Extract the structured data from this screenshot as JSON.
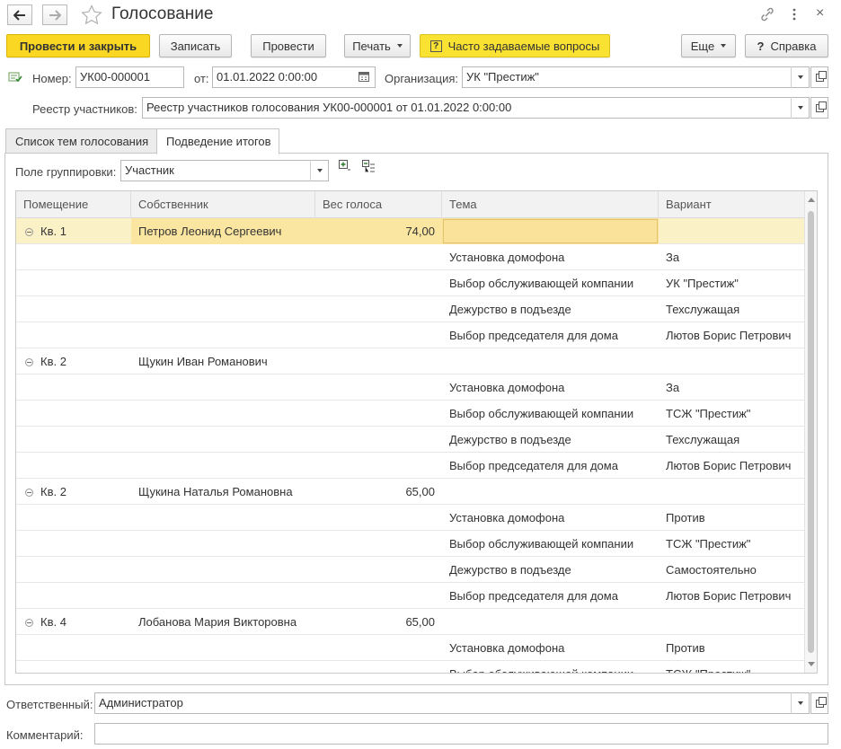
{
  "window": {
    "title": "Голосование",
    "link_icon": "link-icon",
    "more_icon": "more-vertical-icon",
    "close_label": "×"
  },
  "toolbar": {
    "post_close": "Провести и закрыть",
    "save": "Записать",
    "post": "Провести",
    "print": "Печать",
    "faq": "Часто задаваемые вопросы",
    "more": "Еще",
    "help": "Справка"
  },
  "header": {
    "number_label": "Номер:",
    "number_value": "УК00-000001",
    "date_label": "от:",
    "date_value": "01.01.2022  0:00:00",
    "org_label": "Организация:",
    "org_value": "УК \"Престиж\"",
    "registry_label": "Реестр участников:",
    "registry_value": "Реестр участников голосования УК00-000001 от 01.01.2022 0:00:00"
  },
  "tabs": [
    {
      "label": "Список тем голосования"
    },
    {
      "label": "Подведение итогов"
    }
  ],
  "grouping": {
    "label": "Поле группировки:",
    "value": "Участник"
  },
  "table": {
    "columns": [
      "Помещение",
      "Собственник",
      "Вес голоса",
      "Тема",
      "Вариант"
    ],
    "rows": [
      {
        "type": "group",
        "room": "Кв. 1",
        "owner": "Петров Леонид Сергеевич",
        "weight": "74,00",
        "topic": "",
        "variant": ""
      },
      {
        "type": "item",
        "room": "",
        "owner": "",
        "weight": "",
        "topic": "Установка домофона",
        "variant": "За"
      },
      {
        "type": "item",
        "room": "",
        "owner": "",
        "weight": "",
        "topic": "Выбор обслуживающей компании",
        "variant": "УК \"Престиж\""
      },
      {
        "type": "item",
        "room": "",
        "owner": "",
        "weight": "",
        "topic": "Дежурство в подъезде",
        "variant": "Техслужащая"
      },
      {
        "type": "item",
        "room": "",
        "owner": "",
        "weight": "",
        "topic": "Выбор председателя для дома",
        "variant": "Лютов Борис Петрович"
      },
      {
        "type": "group",
        "room": "Кв. 2",
        "owner": "Щукин Иван Романович",
        "weight": "",
        "topic": "",
        "variant": ""
      },
      {
        "type": "item",
        "room": "",
        "owner": "",
        "weight": "",
        "topic": "Установка домофона",
        "variant": "За"
      },
      {
        "type": "item",
        "room": "",
        "owner": "",
        "weight": "",
        "topic": "Выбор обслуживающей компании",
        "variant": "ТСЖ \"Престиж\""
      },
      {
        "type": "item",
        "room": "",
        "owner": "",
        "weight": "",
        "topic": "Дежурство в подъезде",
        "variant": "Техслужащая"
      },
      {
        "type": "item",
        "room": "",
        "owner": "",
        "weight": "",
        "topic": "Выбор председателя для дома",
        "variant": "Лютов Борис Петрович"
      },
      {
        "type": "group",
        "room": "Кв. 2",
        "owner": "Щукина Наталья Романовна",
        "weight": "65,00",
        "topic": "",
        "variant": ""
      },
      {
        "type": "item",
        "room": "",
        "owner": "",
        "weight": "",
        "topic": "Установка домофона",
        "variant": "Против"
      },
      {
        "type": "item",
        "room": "",
        "owner": "",
        "weight": "",
        "topic": "Выбор обслуживающей компании",
        "variant": "ТСЖ \"Престиж\""
      },
      {
        "type": "item",
        "room": "",
        "owner": "",
        "weight": "",
        "topic": "Дежурство в подъезде",
        "variant": "Самостоятельно"
      },
      {
        "type": "item",
        "room": "",
        "owner": "",
        "weight": "",
        "topic": "Выбор председателя для дома",
        "variant": "Лютов Борис Петрович"
      },
      {
        "type": "group",
        "room": "Кв. 4",
        "owner": "Лобанова Мария Викторовна",
        "weight": "65,00",
        "topic": "",
        "variant": ""
      },
      {
        "type": "item",
        "room": "",
        "owner": "",
        "weight": "",
        "topic": "Установка домофона",
        "variant": "Против"
      },
      {
        "type": "item",
        "room": "",
        "owner": "",
        "weight": "",
        "topic": "Выбор обслуживающей компании",
        "variant": "ТСЖ \"Престиж\""
      }
    ]
  },
  "footer": {
    "responsible_label": "Ответственный:",
    "responsible_value": "Администратор",
    "comment_label": "Комментарий:",
    "comment_value": ""
  },
  "colors": {
    "primary_button": "#f9d723",
    "selected_row": "#fbf1c7"
  }
}
